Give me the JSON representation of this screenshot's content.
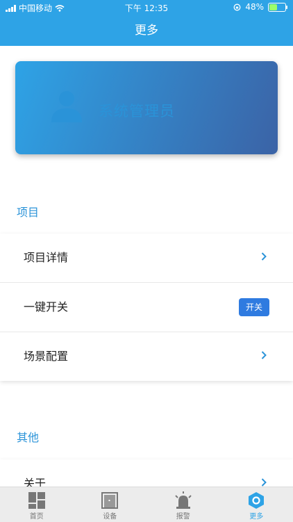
{
  "status": {
    "carrier": "中国移动",
    "time": "下午 12:35",
    "battery": "48%",
    "battery_level": 0.48
  },
  "nav": {
    "title": "更多"
  },
  "profile": {
    "name": "系统管理员"
  },
  "sections": {
    "project": {
      "title": "项目",
      "items": [
        {
          "label": "项目详情"
        },
        {
          "label": "一键开关",
          "button": "开关"
        },
        {
          "label": "场景配置"
        }
      ]
    },
    "other": {
      "title": "其他",
      "items": [
        {
          "label": "关于"
        }
      ]
    }
  },
  "tabs": [
    {
      "label": "首页",
      "icon": "home-grid-icon"
    },
    {
      "label": "设备",
      "icon": "device-cabinet-icon"
    },
    {
      "label": "报警",
      "icon": "alarm-siren-icon"
    },
    {
      "label": "更多",
      "icon": "more-hexagon-icon",
      "active": true
    }
  ],
  "colors": {
    "accent": "#2ea3e6",
    "button": "#2f7be0"
  }
}
